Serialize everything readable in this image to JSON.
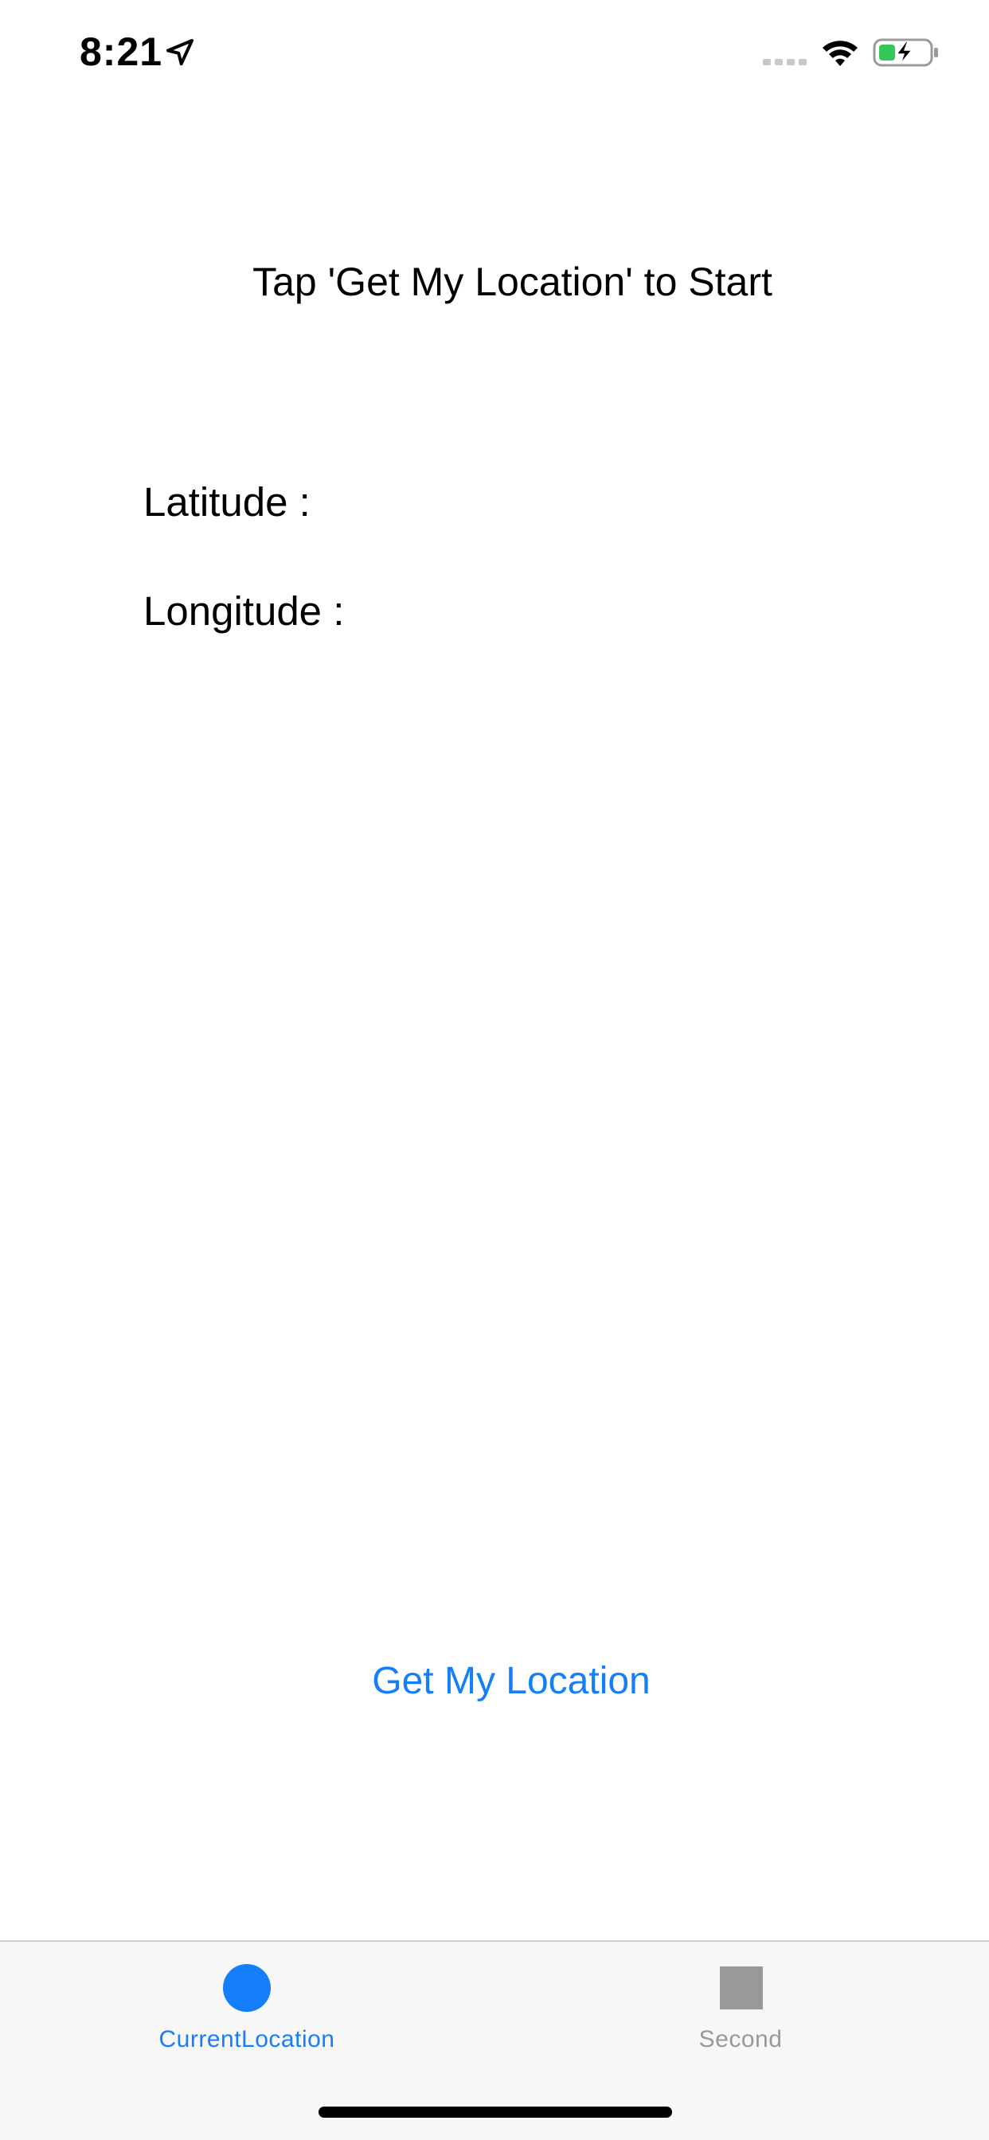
{
  "status_bar": {
    "time": "8:21",
    "location_icon": "location-arrow-icon",
    "signal_icon": "cellular-signal-icon",
    "wifi_icon": "wifi-icon",
    "battery_icon": "battery-charging-icon",
    "battery_color": "#34c759"
  },
  "main": {
    "instruction": "Tap 'Get My Location' to Start",
    "latitude_label": "Latitude :",
    "longitude_label": "Longitude :",
    "get_location_button": "Get My Location"
  },
  "tab_bar": {
    "tabs": [
      {
        "label": "CurrentLocation",
        "icon": "circle-icon",
        "selected": true
      },
      {
        "label": "Second",
        "icon": "square-icon",
        "selected": false
      }
    ]
  },
  "colors": {
    "accent": "#147efb",
    "tab_selected": "#147efb",
    "tab_unselected": "#999999",
    "tab_bar_background": "#f7f7f7"
  }
}
